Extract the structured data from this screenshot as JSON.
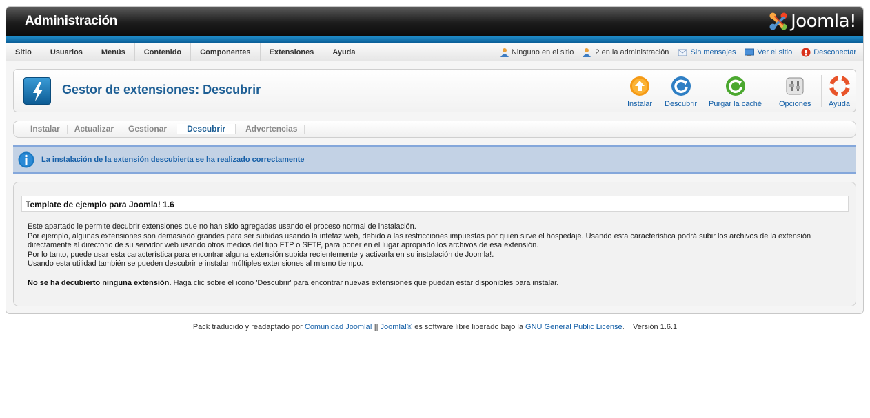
{
  "header": {
    "site_title": "Administración",
    "logo_text": "Joomla!"
  },
  "menu": {
    "items": [
      "Sitio",
      "Usuarios",
      "Menús",
      "Contenido",
      "Componentes",
      "Extensiones",
      "Ayuda"
    ]
  },
  "status": {
    "site_users": "Ninguno en el sitio",
    "admin_users": "2 en la administración",
    "messages": "Sin mensajes",
    "view_site": "Ver el sitio",
    "logout": "Desconectar"
  },
  "toolbar": {
    "title": "Gestor de extensiones: Descubrir",
    "buttons": {
      "install": "Instalar",
      "discover": "Descubrir",
      "purge": "Purgar la caché",
      "options": "Opciones",
      "help": "Ayuda"
    }
  },
  "submenu": {
    "tabs": [
      "Instalar",
      "Actualizar",
      "Gestionar",
      "Descubrir",
      "Advertencias"
    ],
    "active": "Descubrir"
  },
  "message": {
    "text": "La instalación de la extensión descubierta se ha realizado correctamente"
  },
  "content": {
    "template_name": "Template de ejemplo para Joomla! 1.6",
    "description_lines": [
      "Este apartado le permite decubrir extensiones que no han sido agregadas usando el proceso normal de instalación.",
      "Por ejemplo, algunas extensiones son demasiado grandes para ser subidas usando la intefaz web, debido a las restricciones impuestas por quien sirve el hospedaje. Usando esta característica podrá subir los archivos de la extensión",
      "directamente al directorio de su servidor web usando otros medios del tipo FTP o SFTP, para poner en el lugar apropiado los archivos de esa extensión.",
      "Por lo tanto, puede usar esta característica para encontrar alguna extensión subida recientemente y activarla en su instalación de Joomla!.",
      "Usando esta utilidad también se pueden descubrir e instalar múltiples extensiones al mismo tiempo."
    ],
    "none_found_bold": "No se ha decubierto ninguna extensión.",
    "none_found_rest": " Haga clic sobre el icono 'Descubrir' para encontrar nuevas extensiones que puedan estar disponibles para instalar."
  },
  "footer": {
    "prefix": "Pack traducido y readaptado por ",
    "community_link": "Comunidad Joomla!",
    "separator": " || ",
    "joomla_link": "Joomla!®",
    "middle": " es software libre liberado bajo la ",
    "license_link": "GNU General Public License",
    "version": ".    Versión 1.6.1"
  },
  "colors": {
    "header_dark": "#1c1c1c",
    "accent_blue": "#1e5f95",
    "link_blue": "#1560a8",
    "message_bg": "#c3d2e5"
  }
}
